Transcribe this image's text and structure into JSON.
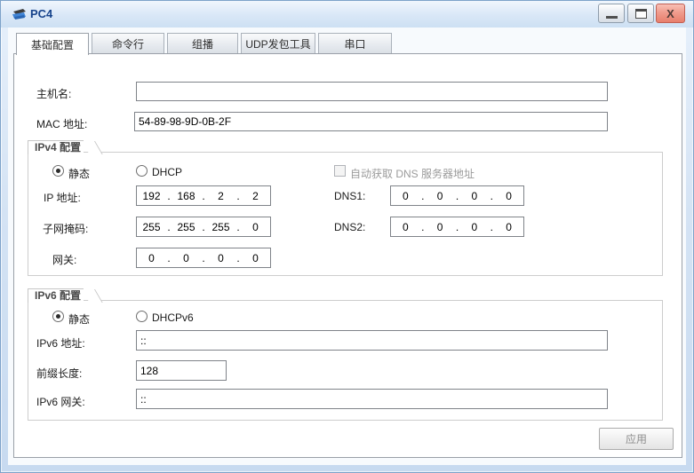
{
  "window": {
    "title": "PC4"
  },
  "icons": {
    "titlebar": "pc-icon",
    "minimize": "minimize-icon",
    "maximize": "maximize-icon",
    "close": "close-icon",
    "close_glyph": "X"
  },
  "glyphs": {
    "dot": "."
  },
  "tabs": [
    {
      "label": "基础配置",
      "active": true
    },
    {
      "label": "命令行",
      "active": false
    },
    {
      "label": "组播",
      "active": false
    },
    {
      "label": "UDP发包工具",
      "active": false
    },
    {
      "label": "串口",
      "active": false
    }
  ],
  "general": {
    "hostname_label": "主机名:",
    "hostname_value": "",
    "mac_label": "MAC 地址:",
    "mac_value": "54-89-98-9D-0B-2F"
  },
  "ipv4": {
    "group_label": "IPv4 配置",
    "static_label": "静态",
    "static_selected": true,
    "dhcp_label": "DHCP",
    "dhcp_selected": false,
    "auto_dns_label": "自动获取 DNS 服务器地址",
    "auto_dns_checked": false,
    "ip_label": "IP 地址:",
    "ip_octets": [
      "192",
      "168",
      "2",
      "2"
    ],
    "mask_label": "子网掩码:",
    "mask_octets": [
      "255",
      "255",
      "255",
      "0"
    ],
    "gateway_label": "网关:",
    "gateway_octets": [
      "0",
      "0",
      "0",
      "0"
    ],
    "dns1_label": "DNS1:",
    "dns1_octets": [
      "0",
      "0",
      "0",
      "0"
    ],
    "dns2_label": "DNS2:",
    "dns2_octets": [
      "0",
      "0",
      "0",
      "0"
    ]
  },
  "ipv6": {
    "group_label": "IPv6 配置",
    "static_label": "静态",
    "static_selected": true,
    "dhcpv6_label": "DHCPv6",
    "dhcpv6_selected": false,
    "address_label": "IPv6 地址:",
    "address_value": "::",
    "prefix_label": "前缀长度:",
    "prefix_value": "128",
    "gateway_label": "IPv6 网关:",
    "gateway_value": "::"
  },
  "apply_button": {
    "label": "应用"
  },
  "colors": {
    "titlebar_text": "#15428b",
    "close_button": "#ee8475",
    "window_border": "#7da2c9",
    "grayed_text": "#9b9b9b"
  }
}
